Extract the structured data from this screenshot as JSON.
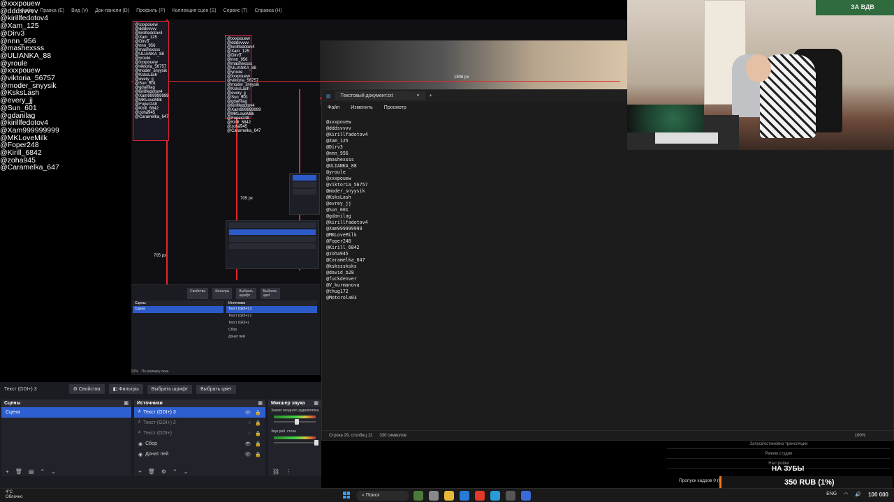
{
  "chat_names": [
    "@xxxpouew",
    "@dddsvvvv",
    "@kirillfedotov4",
    "@Xam_125",
    "@Dirv3",
    "@nnn_956",
    "@mashexsss",
    "@ULIANKA_88",
    "@yroule",
    "@xxxpouew",
    "@viktoria_56757",
    "@moder_snyysik",
    "@KsksLash",
    "@every_jj",
    "@Sun_601",
    "@gdanilag",
    "@kirillfedotov4",
    "@Xam999999999",
    "@MKLoveMilk",
    "@Foper248",
    "@Kirill_6842",
    "@zoha945",
    "@Caramelka_647"
  ],
  "obs_menu": [
    "Файл",
    "Правка (E)",
    "Вид (V)",
    "Док-панели (D)",
    "Профиль (P)",
    "Коллекция сцен (S)",
    "Сервис (T)",
    "Справка (H)"
  ],
  "preview_labels": {
    "px_a": "1806 px",
    "px_b": "705 px",
    "px_c": "705 px"
  },
  "obs_dock": {
    "source_name": "Текст (GDI+) 3",
    "properties_label": "Свойства",
    "filters_label": "Фильтры",
    "font_label": "Выбрать шрифт",
    "color_label": "Выбрать цвет",
    "zoom": "92%",
    "fit_label": "По размеру окна",
    "scenes_header": "Сцены",
    "scenes": [
      "Сцена"
    ],
    "sources_header": "Источники",
    "sources": [
      "Текст (GDI+) 3",
      "Текст (GDI+) 2",
      "Текст (GDI+)",
      "Сбор",
      "Донат пей"
    ],
    "mixer_header": "Микшер звука",
    "mixer_ch1": "Захват входного аудиопотока",
    "mixer_ch2": "Звук раб. стола"
  },
  "notepad": {
    "tab_title": "Текстовый документ.txt",
    "menu": [
      "Файл",
      "Изменить",
      "Просмотр"
    ],
    "lines": [
      "@xxxpouew",
      "@dddsvvvv",
      "@kirillfadotov4",
      "@Xam_125",
      "@Dirv3",
      "@nnn_956",
      "@mashexsss",
      "@ULIANKA_88",
      "@yroule",
      "@xxxpouew",
      "@viktoria_56757",
      "@moder_snyysik",
      "@KsksLash",
      "@evrey_jj",
      "@Sun_601",
      "@gdanilag",
      "@kirillfadotov4",
      "@Xam999999999",
      "@MKLoveMilk",
      "@Foper248",
      "@Kirill_6842",
      "@zoha945",
      "@Caramelka_647",
      "@ksksssksks",
      "@david_b28",
      "@fuckdenver",
      "@V_kurmanova",
      "@thug172",
      "@Motorola03"
    ],
    "status_position": "Строка 29, столбец 12",
    "status_chars": "330 символов",
    "status_zoom": "100%"
  },
  "webcam": {
    "flag_text": "ЗА ВДВ"
  },
  "overlay": {
    "row1": "Запуск/остановка трансляции",
    "row2": "Режим студии",
    "row3": "Настройки",
    "headline": "НА ЗУБЫ",
    "dropped_frames": "Пропуск кадров 0 (0",
    "donation": "350 RUB (1%)",
    "progress_start": "0",
    "progress_end": "100 000"
  },
  "taskbar": {
    "weather_temp": "4°C",
    "weather_desc": "Облачно",
    "search_label": "Поиск",
    "lang": "ENG"
  },
  "colors": {
    "accent_blue": "#2e5fd1",
    "redline": "#e02a2a",
    "donation_accent": "#f07a1a"
  }
}
